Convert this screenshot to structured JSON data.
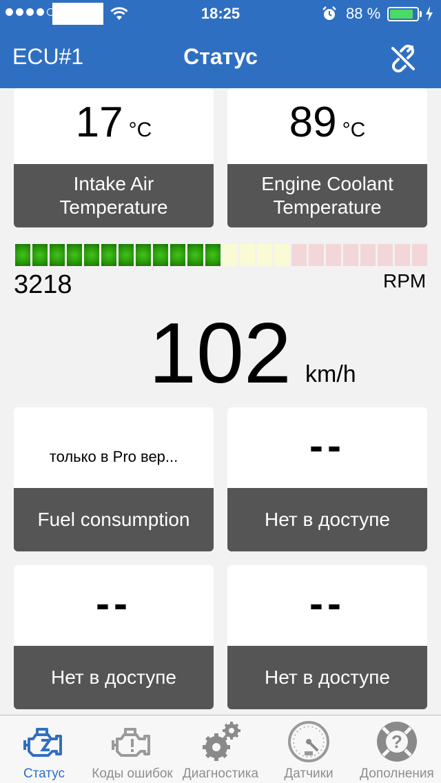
{
  "status_bar": {
    "time": "18:25",
    "battery_percent": "88 %",
    "battery_level": 0.88,
    "signal_bars": 4,
    "signal_total": 5
  },
  "nav": {
    "left": "ECU#1",
    "title": "Статус",
    "right_icon": "unlink-icon"
  },
  "intake": {
    "value": "17",
    "unit": "°C",
    "label_line1": "Intake Air",
    "label_line2": "Temperature"
  },
  "coolant": {
    "value": "89",
    "unit": "°C",
    "label_line1": "Engine Coolant",
    "label_line2": "Temperature"
  },
  "rpm": {
    "value": "3218",
    "unit": "RPM",
    "segments_total": 24,
    "segments_green": 12,
    "segments_yellow": 4,
    "segments_red": 8
  },
  "speed": {
    "value": "102",
    "unit": "km/h"
  },
  "fuel": {
    "value": "только в Pro вер...",
    "label": "Fuel consumption"
  },
  "na1": {
    "value": "--",
    "label": "Нет в доступе"
  },
  "na2": {
    "value": "--",
    "label": "Нет в доступе"
  },
  "na3": {
    "value": "--",
    "label": "Нет в доступе"
  },
  "tabs": [
    {
      "label": "Статус",
      "icon": "check-engine-icon",
      "active": true
    },
    {
      "label": "Коды ошибок",
      "icon": "engine-warning-icon",
      "active": false
    },
    {
      "label": "Диагностика",
      "icon": "gears-icon",
      "active": false
    },
    {
      "label": "Датчики",
      "icon": "gauge-icon",
      "active": false
    },
    {
      "label": "Дополнения",
      "icon": "help-lifebuoy-icon",
      "active": false
    }
  ],
  "colors": {
    "accent": "#2f6fc1",
    "card_label_bg": "#555555",
    "rpm_green": "#2a9a0b",
    "rpm_yellow": "#fafbd4",
    "rpm_red": "#f2d6d8"
  }
}
